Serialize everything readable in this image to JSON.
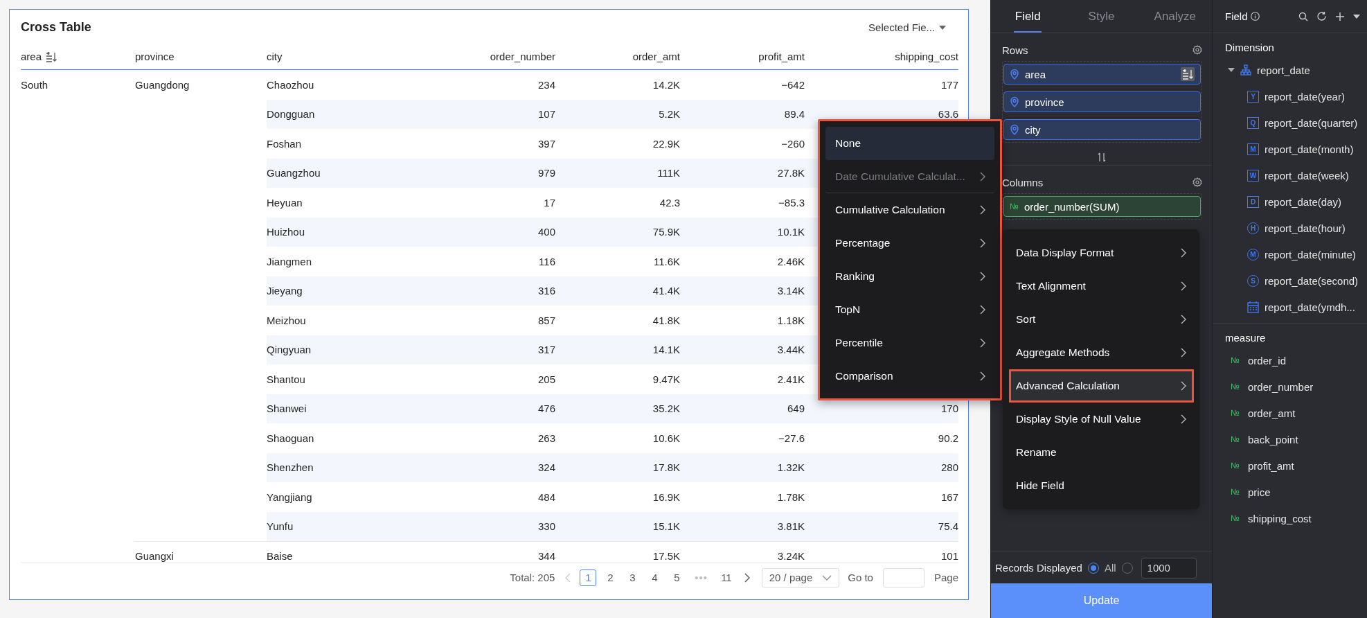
{
  "table_card": {
    "title": "Cross Table",
    "field_selector": "Selected Fie...",
    "columns": [
      {
        "label": "area",
        "kind": "dimension",
        "sorted": true
      },
      {
        "label": "province",
        "kind": "dimension",
        "sorted": false
      },
      {
        "label": "city",
        "kind": "dimension",
        "sorted": false
      },
      {
        "label": "order_number",
        "kind": "measure",
        "sorted": false
      },
      {
        "label": "order_amt",
        "kind": "measure",
        "sorted": false
      },
      {
        "label": "profit_amt",
        "kind": "measure",
        "sorted": false
      },
      {
        "label": "shipping_cost",
        "kind": "measure",
        "sorted": false
      }
    ],
    "rows": [
      {
        "headers": [
          "South",
          "Guangdong",
          "Chaozhou"
        ],
        "values": [
          "234",
          "14.2K",
          "−642",
          "177"
        ]
      },
      {
        "headers": [
          "Dongguan"
        ],
        "values": [
          "107",
          "5.2K",
          "89.4",
          "63.6"
        ]
      },
      {
        "headers": [
          "Foshan"
        ],
        "values": [
          "397",
          "22.9K",
          "−260"
        ]
      },
      {
        "headers": [
          "Guangzhou"
        ],
        "values": [
          "979",
          "111K",
          "27.8K"
        ]
      },
      {
        "headers": [
          "Heyuan"
        ],
        "values": [
          "17",
          "42.3",
          "−85.3"
        ]
      },
      {
        "headers": [
          "Huizhou"
        ],
        "values": [
          "400",
          "75.9K",
          "10.1K"
        ]
      },
      {
        "headers": [
          "Jiangmen"
        ],
        "values": [
          "116",
          "11.6K",
          "2.46K"
        ]
      },
      {
        "headers": [
          "Jieyang"
        ],
        "values": [
          "316",
          "41.4K",
          "3.14K"
        ]
      },
      {
        "headers": [
          "Meizhou"
        ],
        "values": [
          "857",
          "41.8K",
          "1.18K"
        ]
      },
      {
        "headers": [
          "Qingyuan"
        ],
        "values": [
          "317",
          "14.1K",
          "3.44K"
        ]
      },
      {
        "headers": [
          "Shantou"
        ],
        "values": [
          "205",
          "9.47K",
          "2.41K"
        ]
      },
      {
        "headers": [
          "Shanwei"
        ],
        "values": [
          "476",
          "35.2K",
          "649",
          "170"
        ]
      },
      {
        "headers": [
          "Shaoguan"
        ],
        "values": [
          "263",
          "10.6K",
          "−27.6",
          "90.2"
        ]
      },
      {
        "headers": [
          "Shenzhen"
        ],
        "values": [
          "324",
          "17.8K",
          "1.32K",
          "280"
        ]
      },
      {
        "headers": [
          "Yangjiang"
        ],
        "values": [
          "484",
          "16.9K",
          "1.78K",
          "167"
        ]
      },
      {
        "headers": [
          "Yunfu"
        ],
        "values": [
          "330",
          "15.1K",
          "3.81K",
          "75.4"
        ]
      },
      {
        "headers": [
          "Guangxi",
          "Baise"
        ],
        "values": [
          "344",
          "17.5K",
          "3.24K",
          "101"
        ]
      }
    ],
    "pagination": {
      "total": "Total: 205",
      "prev_disabled": true,
      "next_disabled": false,
      "pages": [
        {
          "label": "1",
          "kind": "page",
          "selected": true
        },
        {
          "label": "2",
          "kind": "page",
          "selected": false
        },
        {
          "label": "3",
          "kind": "page",
          "selected": false
        },
        {
          "label": "4",
          "kind": "page",
          "selected": false
        },
        {
          "label": "5",
          "kind": "page",
          "selected": false
        },
        {
          "label": "•••",
          "kind": "ellipsis"
        },
        {
          "label": "11",
          "kind": "page",
          "selected": false
        }
      ],
      "page_size": "20 / page",
      "goto": "Go to",
      "goto_suffix": "Page"
    }
  },
  "config_panel": {
    "tabs": [
      {
        "label": "Field",
        "selected": true
      },
      {
        "label": "Style",
        "selected": false
      },
      {
        "label": "Analyze",
        "selected": false
      }
    ],
    "sections": [
      {
        "title": "Rows",
        "fields": [
          {
            "label": "area",
            "kind": "dimension",
            "sorted": true
          },
          {
            "label": "province",
            "kind": "dimension",
            "sorted": false
          },
          {
            "label": "city",
            "kind": "dimension",
            "sorted": false
          }
        ]
      },
      {
        "title": "Columns",
        "fields": [
          {
            "label": "order_number(SUM)",
            "kind": "measure",
            "icon_text": "№",
            "sorted": false
          }
        ]
      }
    ],
    "records": {
      "label": "Records Displayed",
      "options": [
        {
          "label": "All",
          "selected": true
        },
        {
          "selected": false
        }
      ],
      "limit_value": "1000"
    },
    "update_button": "Update"
  },
  "field_panel": {
    "title": "Field",
    "groups": [
      {
        "title": "Dimension",
        "items": [
          {
            "label": "report_date",
            "kind": "hierarchy",
            "expanded": true,
            "children": [
              {
                "label": "report_date(year)",
                "kind": "calendar",
                "icon_text": "Y"
              },
              {
                "label": "report_date(quarter)",
                "kind": "calendar",
                "icon_text": "Q"
              },
              {
                "label": "report_date(month)",
                "kind": "calendar",
                "icon_text": "M"
              },
              {
                "label": "report_date(week)",
                "kind": "calendar",
                "icon_text": "W"
              },
              {
                "label": "report_date(day)",
                "kind": "calendar",
                "icon_text": "D"
              },
              {
                "label": "report_date(hour)",
                "kind": "clock",
                "icon_text": "H"
              },
              {
                "label": "report_date(minute)",
                "kind": "clock",
                "icon_text": "M"
              },
              {
                "label": "report_date(second)",
                "kind": "clock",
                "icon_text": "S"
              },
              {
                "label": "report_date(ymdh...",
                "kind": "datetime"
              }
            ]
          }
        ]
      },
      {
        "title": "measure",
        "items": [
          {
            "label": "order_id",
            "kind": "measure",
            "icon_text": "№"
          },
          {
            "label": "order_number",
            "kind": "measure",
            "icon_text": "№"
          },
          {
            "label": "order_amt",
            "kind": "measure",
            "icon_text": "№"
          },
          {
            "label": "back_point",
            "kind": "measure",
            "icon_text": "№"
          },
          {
            "label": "profit_amt",
            "kind": "measure",
            "icon_text": "№"
          },
          {
            "label": "price",
            "kind": "measure",
            "icon_text": "№"
          },
          {
            "label": "shipping_cost",
            "kind": "measure",
            "icon_text": "№"
          }
        ]
      }
    ]
  },
  "calc_submenu": {
    "annotated": true,
    "items": [
      {
        "label": "None",
        "selected": true,
        "disabled": false,
        "has_submenu": false,
        "divider_after": false
      },
      {
        "label": "Date Cumulative Calculat...",
        "selected": false,
        "disabled": true,
        "has_submenu": true,
        "divider_after": true
      },
      {
        "label": "Cumulative Calculation",
        "selected": false,
        "disabled": false,
        "has_submenu": true,
        "divider_after": false
      },
      {
        "label": "Percentage",
        "selected": false,
        "disabled": false,
        "has_submenu": true,
        "divider_after": false
      },
      {
        "label": "Ranking",
        "selected": false,
        "disabled": false,
        "has_submenu": true,
        "divider_after": false
      },
      {
        "label": "TopN",
        "selected": false,
        "disabled": false,
        "has_submenu": true,
        "divider_after": false
      },
      {
        "label": "Percentile",
        "selected": false,
        "disabled": false,
        "has_submenu": true,
        "divider_after": false
      },
      {
        "label": "Comparison",
        "selected": false,
        "disabled": false,
        "has_submenu": true,
        "divider_after": false
      }
    ]
  },
  "field_menu": {
    "annotated": false,
    "items": [
      {
        "label": "Data Display Format",
        "selected": false,
        "annotated": false,
        "has_submenu": true
      },
      {
        "label": "Text Alignment",
        "selected": false,
        "annotated": false,
        "has_submenu": true
      },
      {
        "label": "Sort",
        "selected": false,
        "annotated": false,
        "has_submenu": true
      },
      {
        "label": "Aggregate Methods",
        "selected": false,
        "annotated": false,
        "has_submenu": true
      },
      {
        "label": "Advanced Calculation",
        "selected": true,
        "annotated": true,
        "has_submenu": true
      },
      {
        "label": "Display Style of Null Value",
        "selected": false,
        "annotated": false,
        "has_submenu": true
      },
      {
        "label": "Rename",
        "selected": false,
        "annotated": false,
        "has_submenu": false
      },
      {
        "label": "Hide Field",
        "selected": false,
        "annotated": false,
        "has_submenu": false
      }
    ]
  }
}
